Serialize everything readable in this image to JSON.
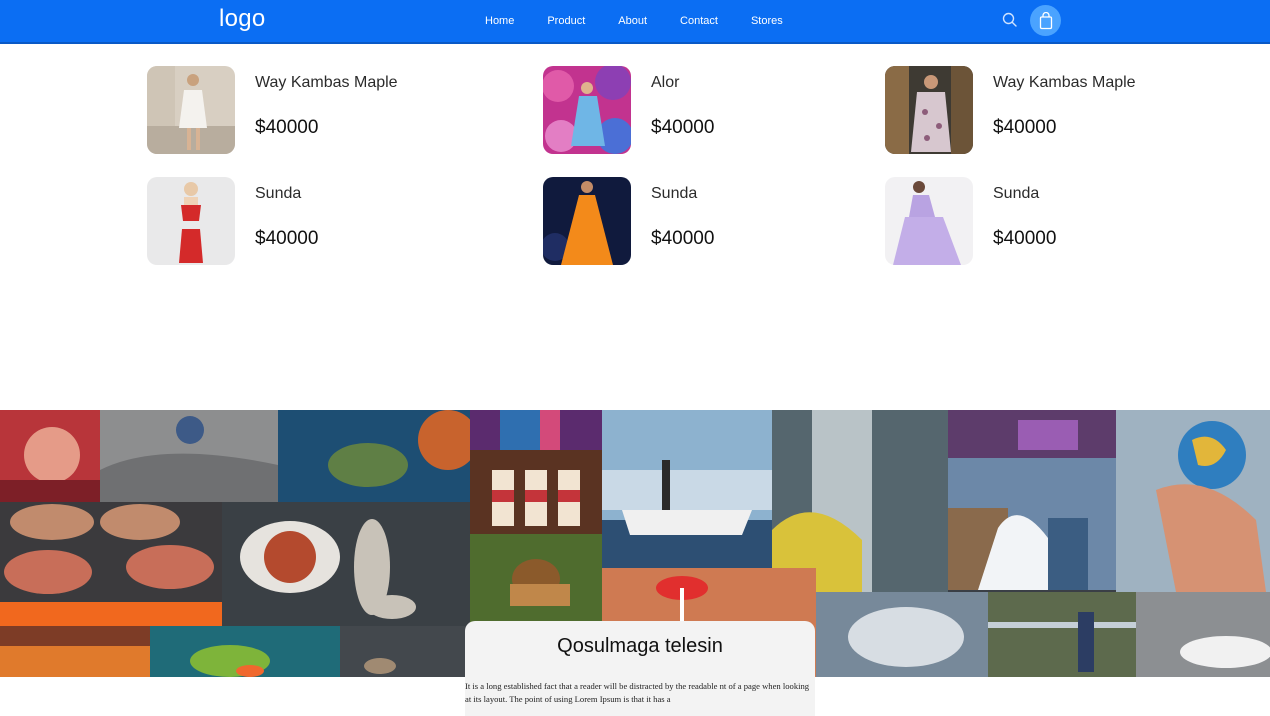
{
  "header": {
    "logo": "logo",
    "nav": [
      "Home",
      "Product",
      "About",
      "Contact",
      "Stores"
    ],
    "search_icon": "search-icon",
    "cart_icon": "shopping-bag-icon",
    "colors": {
      "bar": "#0b6ef3",
      "cart_bg": "#4aa3ff"
    }
  },
  "products": [
    {
      "name": "Way Kambas Maple",
      "price": "$40000"
    },
    {
      "name": "Alor",
      "price": "$40000"
    },
    {
      "name": "Way Kambas Maple",
      "price": "$40000"
    },
    {
      "name": "Sunda",
      "price": "$40000"
    },
    {
      "name": "Sunda",
      "price": "$40000"
    },
    {
      "name": "Sunda",
      "price": "$40000"
    }
  ],
  "banner": {
    "title": "Qosulmaga telesin",
    "text": "It is a long established fact that a reader will be distracted by the readable nt of a page when looking at its layout. The point of using Lorem Ipsum is that it has a"
  }
}
